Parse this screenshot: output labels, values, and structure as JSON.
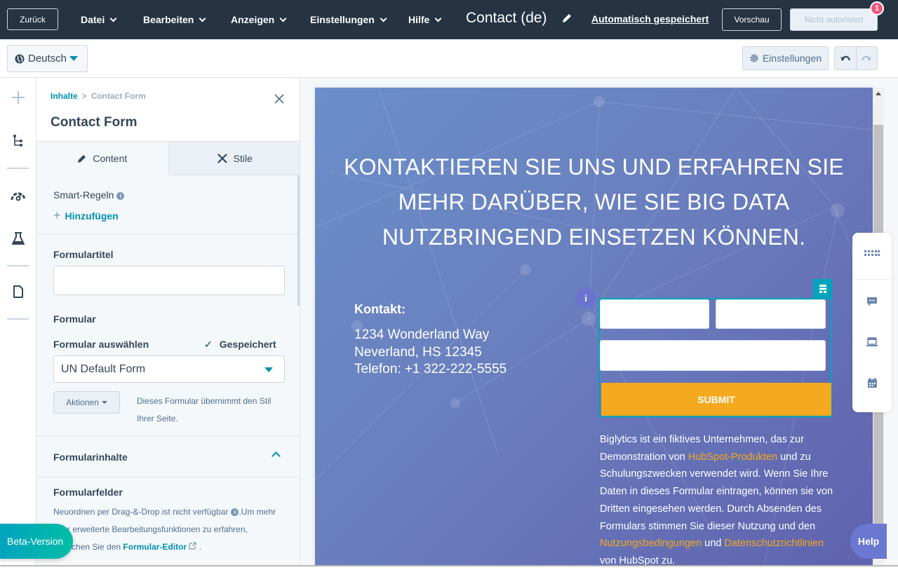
{
  "topbar": {
    "back_label": "Zurück",
    "menus": [
      "Datei",
      "Bearbeiten",
      "Anzeigen",
      "Einstellungen",
      "Hilfe"
    ],
    "document_title": "Contact (de)",
    "autosave_label": "Automatisch gespeichert",
    "preview_label": "Vorschau",
    "publish_label": "Nicht autorisiert",
    "notification_count": "1"
  },
  "subbar": {
    "language": "Deutsch",
    "settings_label": "Einstellungen"
  },
  "panel": {
    "breadcrumb": [
      "Inhalte",
      "Contact Form"
    ],
    "title": "Contact Form",
    "tabs": [
      {
        "label": "Content",
        "active": true
      },
      {
        "label": "Stile",
        "active": false
      }
    ],
    "smart_rules_label": "Smart-Regeln",
    "add_label": "Hinzufügen",
    "form_title_label": "Formulartitel",
    "form_title_value": "",
    "form_section_label": "Formular",
    "select_form_label": "Formular auswählen",
    "saved_label": "Gespeichert",
    "selected_form": "UN Default Form",
    "actions_label": "Aktionen",
    "form_style_note": "Dieses Formular übernimmt den Stil Ihrer Seite.",
    "form_contents_label": "Formularinhalte",
    "form_fields_label": "Formularfelder",
    "fields_note_1": "Neuordnen per Drag-&-Drop ist nicht verfügbar",
    "fields_note_2": ".Um mehr über erweiterte Bearbeitungsfunktionen zu erfahren, besuchen Sie den ",
    "fields_note_link": "Formular-Editor",
    "fields_note_end": " ."
  },
  "preview": {
    "hero_lines": [
      "KONTAKTIEREN SIE UNS UND ERFAHREN SIE",
      "MEHR DARÜBER, WIE SIE BIG DATA",
      "NUTZBRINGEND EINSETZEN KÖNNEN."
    ],
    "contact_heading": "Kontakt:",
    "address_lines": [
      "1234 Wonderland Way",
      "Neverland, HS 12345",
      "Telefon: +1 322-222-5555"
    ],
    "submit_label": "SUBMIT",
    "info_bubble": "i",
    "disclaimer": {
      "p1": "Biglytics ist ein fiktives Unternehmen, das zur Demonstration von ",
      "link1": "HubSpot-Produkten",
      "p2": " und zu Schulungszwecken verwendet wird. Wenn Sie Ihre Daten in dieses Formular eintragen, können sie von Dritten eingesehen werden. Durch Absenden des Formulars stimmen Sie dieser Nutzung und den ",
      "link2": "Nutzungsbedingungen",
      "p3": " und ",
      "link3": "Datenschutzrichtlinien",
      "p4": " von HubSpot zu."
    }
  },
  "floating": {
    "beta_label": "Beta-Version",
    "help_label": "Help"
  },
  "colors": {
    "topbar_bg": "#253342",
    "accent": "#0091ae",
    "submit": "#f5a91e",
    "badge": "#f2547d"
  }
}
